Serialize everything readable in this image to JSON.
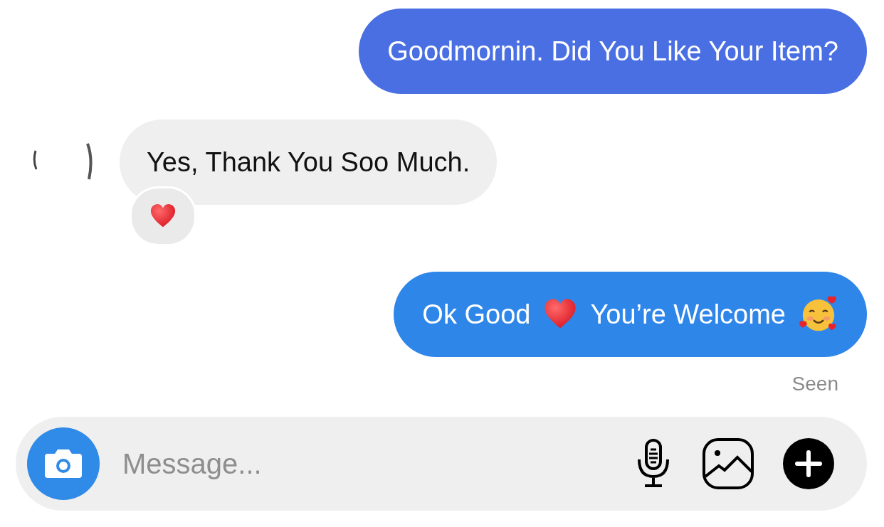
{
  "messages": [
    {
      "kind": "outgoing",
      "color": "#4a6fe2",
      "parts": [
        {
          "kind": "text",
          "text": "Goodmornin. Did You Like Your Item?"
        }
      ]
    },
    {
      "kind": "incoming",
      "parts": [
        {
          "kind": "text",
          "text": "Yes, Thank You Soo Much."
        }
      ],
      "reaction": {
        "kind": "heart"
      }
    },
    {
      "kind": "outgoing",
      "color": "#2f86e9",
      "parts": [
        {
          "kind": "text",
          "text": "Ok Good"
        },
        {
          "kind": "heart"
        },
        {
          "kind": "text",
          "text": "You’re Welcome"
        },
        {
          "kind": "smiling-face"
        }
      ]
    }
  ],
  "status": "Seen",
  "composer": {
    "placeholder": "Message...",
    "buttons": [
      {
        "kind": "mic"
      },
      {
        "kind": "image"
      },
      {
        "kind": "plus"
      }
    ]
  }
}
